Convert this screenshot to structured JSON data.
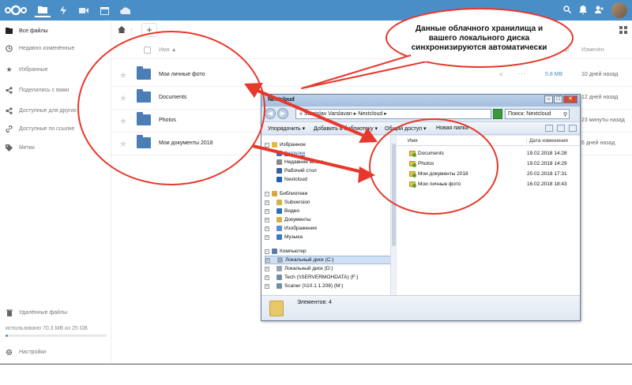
{
  "header": {
    "apps": [
      "files-icon",
      "activity-icon",
      "video-icon",
      "calendar-icon",
      "cloud-icon"
    ],
    "accent": "#4a8ec8"
  },
  "sidebar": {
    "items": [
      {
        "label": "Все файлы",
        "icon": "folder-icon"
      },
      {
        "label": "Недавно изменённые",
        "icon": "clock-icon"
      },
      {
        "label": "Избранные",
        "icon": "star-icon"
      },
      {
        "label": "Поделились с вами",
        "icon": "share-icon"
      },
      {
        "label": "Доступные для других",
        "icon": "share-icon"
      },
      {
        "label": "Доступные по ссылке",
        "icon": "link-icon"
      },
      {
        "label": "Метки",
        "icon": "tag-icon"
      }
    ],
    "trash": "Удалённые файлы",
    "quota_text": "использовано 70.3 MB из 25 GB",
    "quota_fraction": 0.003,
    "settings": "Настройки"
  },
  "files": {
    "col_name": "Имя ▲",
    "col_size": "Размер",
    "col_modified": "Изменён",
    "rows": [
      {
        "name": "Мои личные фото",
        "size": "5.8 MB",
        "modified": "10 дней назад"
      },
      {
        "name": "Documents",
        "size": "",
        "modified": "12 дней назад"
      },
      {
        "name": "Photos",
        "size": "",
        "modified": "23 минуты назад"
      },
      {
        "name": "Мои документы 2018",
        "size": "",
        "modified": "6 дней назад"
      }
    ]
  },
  "explorer": {
    "title": "Nextcloud",
    "address": "« Stanislav Varslavan ▸ Nextcloud ▸",
    "search_placeholder": "Поиск: Nextcloud",
    "toolbar": [
      "Упорядочить ▾",
      "Добавить в библиотеку ▾",
      "Общий доступ ▾",
      "Новая папка"
    ],
    "nav": [
      {
        "label": "Избранное",
        "level": 0,
        "color": "#e8b93a",
        "toggle": "−"
      },
      {
        "label": "Загрузки",
        "level": 1,
        "color": "#3f72b8",
        "link": true
      },
      {
        "label": "Недавние места",
        "level": 1,
        "color": "#8a8a8a"
      },
      {
        "label": "Рабочий стол",
        "level": 1,
        "color": "#3a5f9a"
      },
      {
        "label": "Nextcloud",
        "level": 1,
        "color": "#1f5fb0"
      },
      {
        "label": "",
        "level": -1
      },
      {
        "label": "Библиотеки",
        "level": 0,
        "color": "#d9a93a",
        "toggle": "−"
      },
      {
        "label": "Subversion",
        "level": 1,
        "color": "#d4b24a",
        "toggle": "+"
      },
      {
        "label": "Видео",
        "level": 1,
        "color": "#2d6fb8",
        "toggle": "+"
      },
      {
        "label": "Документы",
        "level": 1,
        "color": "#d4b24a",
        "toggle": "+"
      },
      {
        "label": "Изображения",
        "level": 1,
        "color": "#5a8fcf",
        "toggle": "+"
      },
      {
        "label": "Музыка",
        "level": 1,
        "color": "#3c78c0",
        "toggle": "+"
      },
      {
        "label": "",
        "level": -1
      },
      {
        "label": "Компьютер",
        "level": 0,
        "color": "#5a7da5",
        "toggle": "−"
      },
      {
        "label": "Локальный диск (C:)",
        "level": 1,
        "color": "#9aa6b2",
        "toggle": "+",
        "selected": true
      },
      {
        "label": "Локальный диск (D:)",
        "level": 1,
        "color": "#9aa6b2",
        "toggle": "+"
      },
      {
        "label": "Tech (\\\\SERVERMOHDATA) (F:)",
        "level": 1,
        "color": "#6f8fa8",
        "toggle": "+"
      },
      {
        "label": "Scaner (\\\\10.1.1.208) (M:)",
        "level": 1,
        "color": "#6f8fa8",
        "toggle": "+"
      }
    ],
    "col_name": "Имя",
    "col_date": "Дата изменения",
    "rows": [
      {
        "name": "Documents",
        "date": "19.02.2018 14:28"
      },
      {
        "name": "Photos",
        "date": "19.02.2018 14:29"
      },
      {
        "name": "Мои документы 2018",
        "date": "20.02.2018 17:31"
      },
      {
        "name": "Мои личные фото",
        "date": "16.02.2018 18:43"
      }
    ],
    "status": "Элементов: 4"
  },
  "callout": {
    "text": "Данные облачного хранилища и вашего локального диска синхронизируются автоматически",
    "color": "#e8372b"
  }
}
